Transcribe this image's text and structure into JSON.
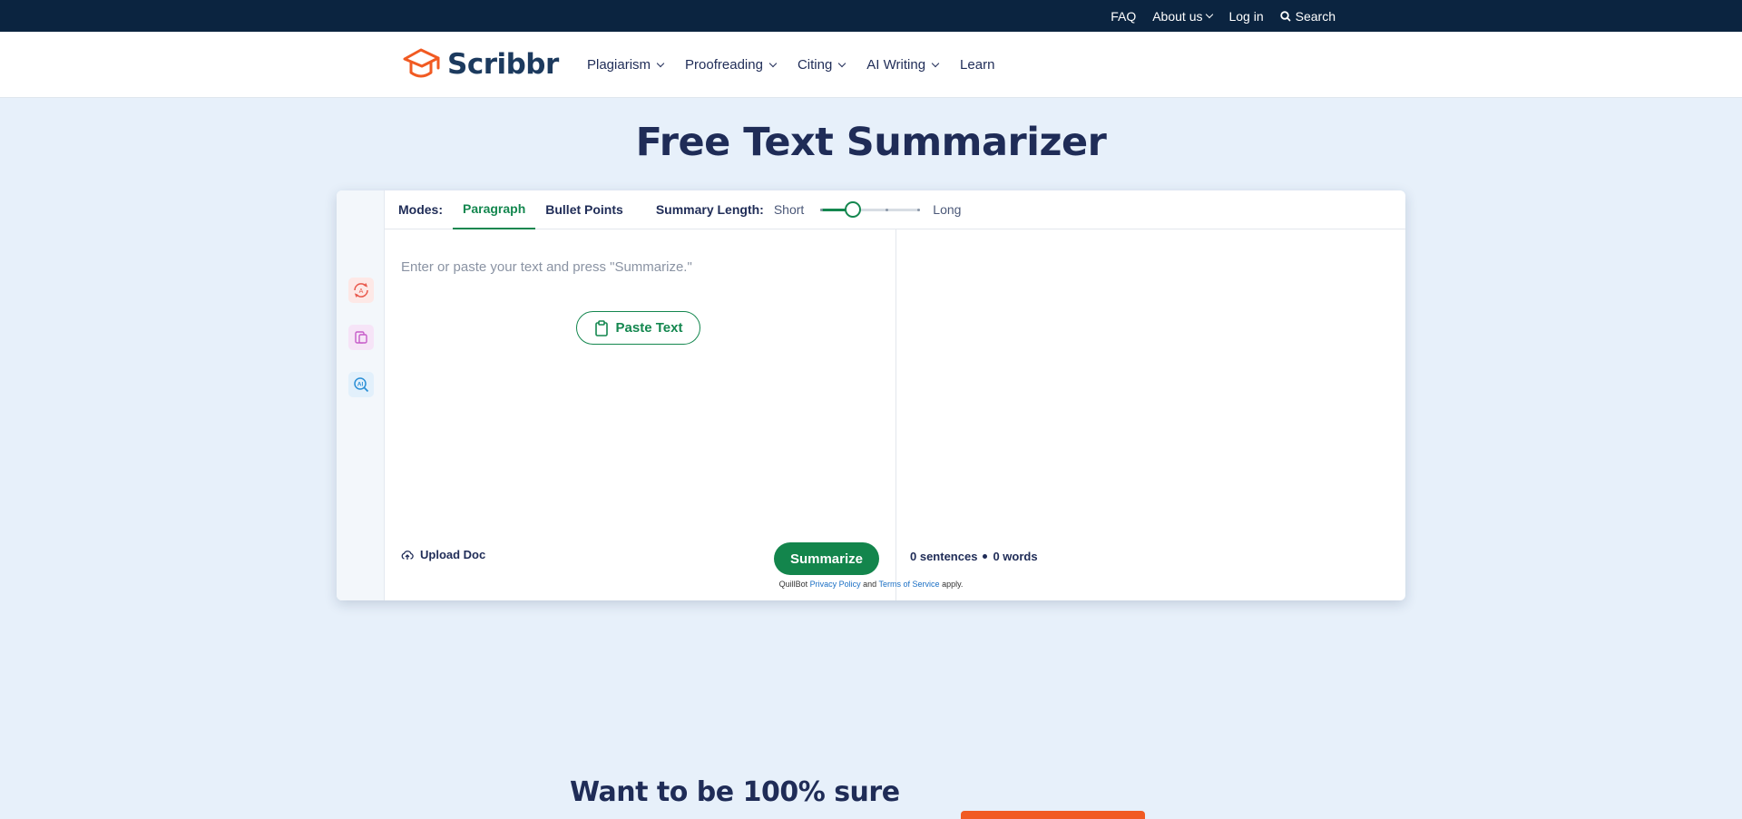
{
  "topbar": {
    "faq": "FAQ",
    "about": "About us",
    "login": "Log in",
    "search": "Search"
  },
  "nav": {
    "logo_text": "Scribbr",
    "items": [
      {
        "label": "Plagiarism",
        "dropdown": true
      },
      {
        "label": "Proofreading",
        "dropdown": true
      },
      {
        "label": "Citing",
        "dropdown": true
      },
      {
        "label": "AI Writing",
        "dropdown": true
      },
      {
        "label": "Learn",
        "dropdown": false
      }
    ]
  },
  "page": {
    "title": "Free Text Summarizer"
  },
  "tool": {
    "modes_label": "Modes:",
    "modes": [
      "Paragraph",
      "Bullet Points"
    ],
    "active_mode": "Paragraph",
    "summary_length_label": "Summary Length:",
    "short_label": "Short",
    "long_label": "Long",
    "summary_length_value": 0.33,
    "input_placeholder": "Enter or paste your text and press \"Summarize.\"",
    "paste_button": "Paste Text",
    "upload_label": "Upload Doc",
    "summarize_button": "Summarize",
    "sentences_count": "0 sentences",
    "words_count": "0 words",
    "side_icons": [
      "paraphraser-icon",
      "document-compare-icon",
      "ai-detector-icon"
    ]
  },
  "legal": {
    "prefix": "QuillBot",
    "privacy": "Privacy Policy",
    "and": "and",
    "terms": "Terms of Service",
    "suffix": "apply."
  },
  "promo": {
    "heading": "Want to be 100% sure"
  },
  "colors": {
    "topbar_bg": "#0b2440",
    "page_bg": "#e7f0fa",
    "accent_green": "#13854c",
    "brand_orange": "#f15a22",
    "text_navy": "#1f2c57"
  }
}
